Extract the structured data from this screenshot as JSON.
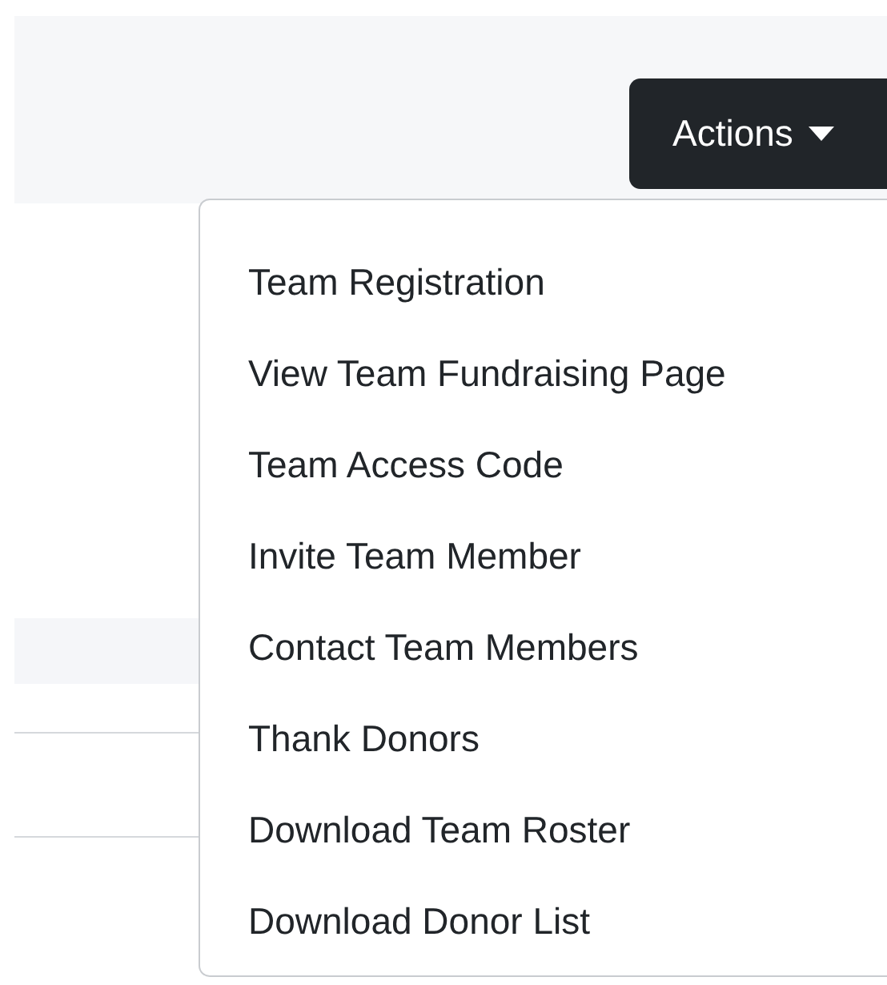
{
  "actions_button": {
    "label": "Actions"
  },
  "actions_menu": {
    "items": [
      {
        "label": "Team Registration"
      },
      {
        "label": "View Team Fundraising Page"
      },
      {
        "label": "Team Access Code"
      },
      {
        "label": "Invite Team Member"
      },
      {
        "label": "Contact Team Members"
      },
      {
        "label": "Thank Donors"
      },
      {
        "label": "Download Team Roster"
      },
      {
        "label": "Download Donor List"
      }
    ]
  }
}
